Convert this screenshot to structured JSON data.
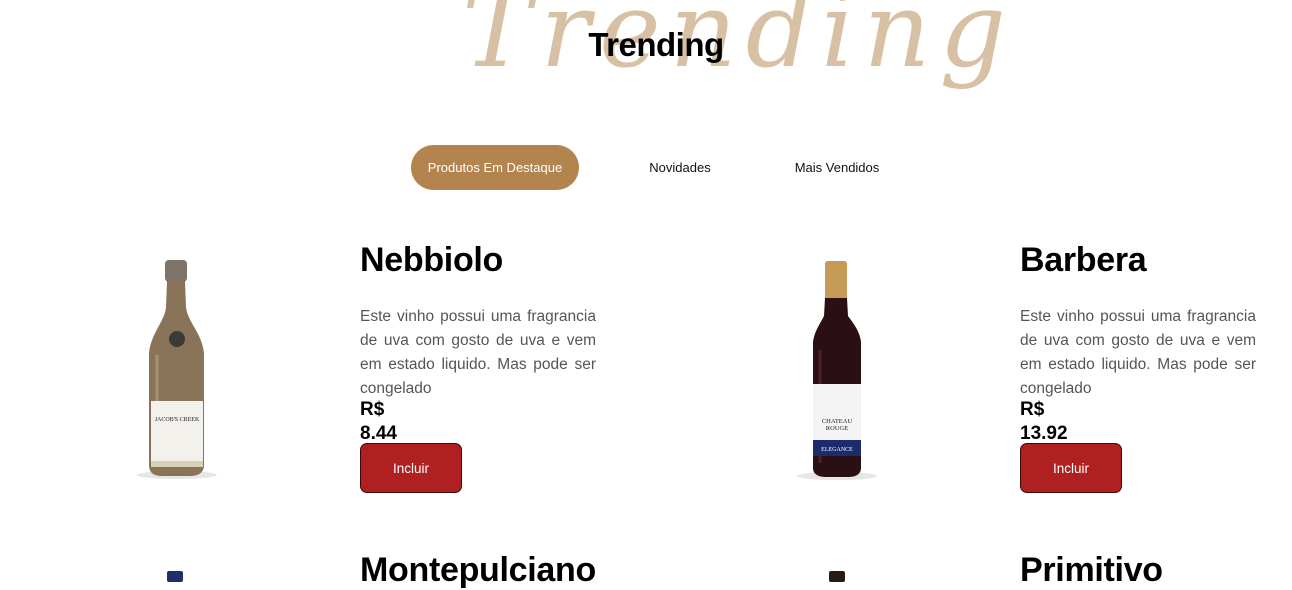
{
  "section": {
    "script_word": "Trending",
    "title": "Trending"
  },
  "tabs": [
    {
      "label": "Produtos Em Destaque",
      "active": true
    },
    {
      "label": "Novidades",
      "active": false
    },
    {
      "label": "Mais Vendidos",
      "active": false
    }
  ],
  "products": [
    {
      "name": "Nebbiolo",
      "description": "Este vinho possui uma fragrancia de uva com gosto de uva e vem em estado liquido. Mas pode ser congelado",
      "price": "R$ 8.44",
      "button": "Incluir",
      "label_lines": [
        "JACOB'S CREEK"
      ]
    },
    {
      "name": "Barbera",
      "description": "Este vinho possui uma fragrancia de uva com gosto de uva e vem em estado liquido. Mas pode ser congelado",
      "price": "R$ 13.92",
      "button": "Incluir",
      "label_lines": [
        "CHATEAU",
        "ROUGE",
        "ELEGANCE"
      ]
    },
    {
      "name": "Montepulciano"
    },
    {
      "name": "Primitivo"
    }
  ],
  "colors": {
    "accent": "#b4844f",
    "button": "#b02021",
    "script_word": "#d8c0a4"
  }
}
